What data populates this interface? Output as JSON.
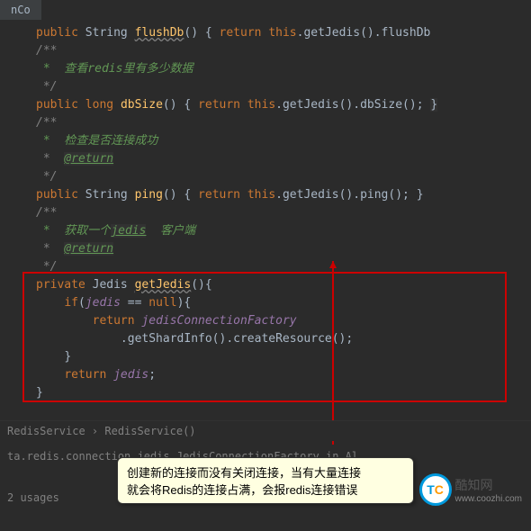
{
  "tab": "nCo",
  "lines": {
    "l0": {
      "kw": "public ",
      "ty": "String ",
      "mth": "flushDb",
      "pn": "() { ",
      "rk": "return ",
      "th": "this",
      "r": ".getJedis().flushDb"
    },
    "cmt1a": "/**",
    "cmt1b": " *  查看redis里有多少数据",
    "cmt1c": " */",
    "dbsize": {
      "kw": "public ",
      "ty": "long ",
      "mth": "dbSize",
      "pn": "() { ",
      "rk": "return ",
      "th": "this",
      "r": ".getJedis().dbSize(); "
    },
    "cmt2a": "/**",
    "cmt2b": " *  检查是否连接成功",
    "cmt2c": " *  ",
    "ret2": "@return",
    "cmt2d": " */",
    "ping": {
      "kw": "public ",
      "ty": "String ",
      "mth": "ping",
      "pn": "() { ",
      "rk": "return ",
      "th": "this",
      "r": ".getJedis().ping(); }"
    },
    "cmt3a": "/**",
    "cmt3b": " *  获取一个",
    "jedis": "jedis",
    "cmt3b2": "  客户端",
    "cmt3c": " *  ",
    "ret3": "@return",
    "cmt3d": " */",
    "gj": {
      "kw": "private ",
      "ty": "Jedis ",
      "mth": "getJedis",
      "pn": "(){"
    },
    "if": {
      "kw": "if",
      "p": "(",
      "f": "jedis",
      "r": " == ",
      "nl": "null",
      "c": "){"
    },
    "ret": {
      "kw": "return ",
      "f": "jedisConnectionFactory"
    },
    "chain": ".getShardInfo().createResource();",
    "cb": "}",
    "rj": {
      "kw": "return ",
      "f": "jedis",
      "s": ";"
    },
    "cb2": "}"
  },
  "breadcrumb": "RedisService  ›  RedisService()",
  "info": "ta.redis.connection.jedis.JedisConnectionFactory in Al",
  "usages": "2 usages",
  "tooltip_l1": "创建新的连接而没有关闭连接，当有大量连接",
  "tooltip_l2": "就会将Redis的连接占满，会报redis连接错误",
  "logo_text": "酷知网",
  "logo_sub": "www.coozhi.com"
}
